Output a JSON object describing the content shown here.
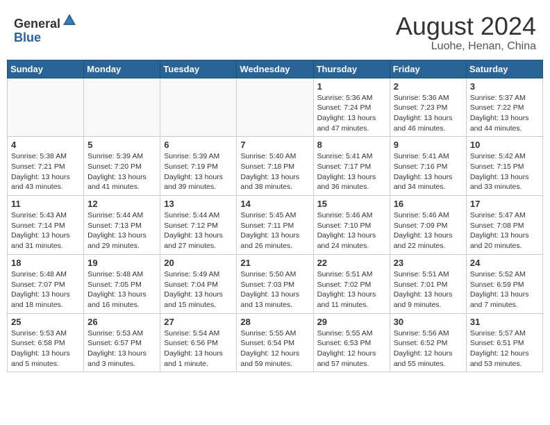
{
  "header": {
    "logo_general": "General",
    "logo_blue": "Blue",
    "month_year": "August 2024",
    "location": "Luohe, Henan, China"
  },
  "weekdays": [
    "Sunday",
    "Monday",
    "Tuesday",
    "Wednesday",
    "Thursday",
    "Friday",
    "Saturday"
  ],
  "weeks": [
    [
      {
        "day": "",
        "detail": ""
      },
      {
        "day": "",
        "detail": ""
      },
      {
        "day": "",
        "detail": ""
      },
      {
        "day": "",
        "detail": ""
      },
      {
        "day": "1",
        "detail": "Sunrise: 5:36 AM\nSunset: 7:24 PM\nDaylight: 13 hours\nand 47 minutes."
      },
      {
        "day": "2",
        "detail": "Sunrise: 5:36 AM\nSunset: 7:23 PM\nDaylight: 13 hours\nand 46 minutes."
      },
      {
        "day": "3",
        "detail": "Sunrise: 5:37 AM\nSunset: 7:22 PM\nDaylight: 13 hours\nand 44 minutes."
      }
    ],
    [
      {
        "day": "4",
        "detail": "Sunrise: 5:38 AM\nSunset: 7:21 PM\nDaylight: 13 hours\nand 43 minutes."
      },
      {
        "day": "5",
        "detail": "Sunrise: 5:39 AM\nSunset: 7:20 PM\nDaylight: 13 hours\nand 41 minutes."
      },
      {
        "day": "6",
        "detail": "Sunrise: 5:39 AM\nSunset: 7:19 PM\nDaylight: 13 hours\nand 39 minutes."
      },
      {
        "day": "7",
        "detail": "Sunrise: 5:40 AM\nSunset: 7:18 PM\nDaylight: 13 hours\nand 38 minutes."
      },
      {
        "day": "8",
        "detail": "Sunrise: 5:41 AM\nSunset: 7:17 PM\nDaylight: 13 hours\nand 36 minutes."
      },
      {
        "day": "9",
        "detail": "Sunrise: 5:41 AM\nSunset: 7:16 PM\nDaylight: 13 hours\nand 34 minutes."
      },
      {
        "day": "10",
        "detail": "Sunrise: 5:42 AM\nSunset: 7:15 PM\nDaylight: 13 hours\nand 33 minutes."
      }
    ],
    [
      {
        "day": "11",
        "detail": "Sunrise: 5:43 AM\nSunset: 7:14 PM\nDaylight: 13 hours\nand 31 minutes."
      },
      {
        "day": "12",
        "detail": "Sunrise: 5:44 AM\nSunset: 7:13 PM\nDaylight: 13 hours\nand 29 minutes."
      },
      {
        "day": "13",
        "detail": "Sunrise: 5:44 AM\nSunset: 7:12 PM\nDaylight: 13 hours\nand 27 minutes."
      },
      {
        "day": "14",
        "detail": "Sunrise: 5:45 AM\nSunset: 7:11 PM\nDaylight: 13 hours\nand 26 minutes."
      },
      {
        "day": "15",
        "detail": "Sunrise: 5:46 AM\nSunset: 7:10 PM\nDaylight: 13 hours\nand 24 minutes."
      },
      {
        "day": "16",
        "detail": "Sunrise: 5:46 AM\nSunset: 7:09 PM\nDaylight: 13 hours\nand 22 minutes."
      },
      {
        "day": "17",
        "detail": "Sunrise: 5:47 AM\nSunset: 7:08 PM\nDaylight: 13 hours\nand 20 minutes."
      }
    ],
    [
      {
        "day": "18",
        "detail": "Sunrise: 5:48 AM\nSunset: 7:07 PM\nDaylight: 13 hours\nand 18 minutes."
      },
      {
        "day": "19",
        "detail": "Sunrise: 5:48 AM\nSunset: 7:05 PM\nDaylight: 13 hours\nand 16 minutes."
      },
      {
        "day": "20",
        "detail": "Sunrise: 5:49 AM\nSunset: 7:04 PM\nDaylight: 13 hours\nand 15 minutes."
      },
      {
        "day": "21",
        "detail": "Sunrise: 5:50 AM\nSunset: 7:03 PM\nDaylight: 13 hours\nand 13 minutes."
      },
      {
        "day": "22",
        "detail": "Sunrise: 5:51 AM\nSunset: 7:02 PM\nDaylight: 13 hours\nand 11 minutes."
      },
      {
        "day": "23",
        "detail": "Sunrise: 5:51 AM\nSunset: 7:01 PM\nDaylight: 13 hours\nand 9 minutes."
      },
      {
        "day": "24",
        "detail": "Sunrise: 5:52 AM\nSunset: 6:59 PM\nDaylight: 13 hours\nand 7 minutes."
      }
    ],
    [
      {
        "day": "25",
        "detail": "Sunrise: 5:53 AM\nSunset: 6:58 PM\nDaylight: 13 hours\nand 5 minutes."
      },
      {
        "day": "26",
        "detail": "Sunrise: 5:53 AM\nSunset: 6:57 PM\nDaylight: 13 hours\nand 3 minutes."
      },
      {
        "day": "27",
        "detail": "Sunrise: 5:54 AM\nSunset: 6:56 PM\nDaylight: 13 hours\nand 1 minute."
      },
      {
        "day": "28",
        "detail": "Sunrise: 5:55 AM\nSunset: 6:54 PM\nDaylight: 12 hours\nand 59 minutes."
      },
      {
        "day": "29",
        "detail": "Sunrise: 5:55 AM\nSunset: 6:53 PM\nDaylight: 12 hours\nand 57 minutes."
      },
      {
        "day": "30",
        "detail": "Sunrise: 5:56 AM\nSunset: 6:52 PM\nDaylight: 12 hours\nand 55 minutes."
      },
      {
        "day": "31",
        "detail": "Sunrise: 5:57 AM\nSunset: 6:51 PM\nDaylight: 12 hours\nand 53 minutes."
      }
    ]
  ]
}
